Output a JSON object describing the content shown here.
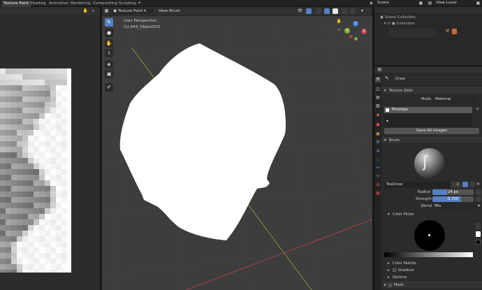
{
  "topbar": {
    "tabs": [
      "Texture Paint",
      "Shading",
      "Animation",
      "Rendering",
      "Compositing",
      "Scripting"
    ],
    "add_tab_icon": "plus-icon",
    "scene_label": "Scene",
    "view_layer_label": "View Layer"
  },
  "image_editor": {
    "pixels": "grayscale-texture"
  },
  "viewport": {
    "mode_label": "Texture Paint",
    "menu_items": [
      "View",
      "Brush"
    ],
    "perspective_label": "User Perspective",
    "object_label": "(1) 843_Object023",
    "gizmo_axes": [
      "X",
      "Y",
      "Z"
    ]
  },
  "toolbar": {
    "tools": [
      "draw-brush-icon",
      "soften-icon",
      "smear-icon",
      "clone-icon",
      "fill-icon",
      "mask-icon",
      "annotate-icon"
    ]
  },
  "outliner": {
    "root": "Scene Collection",
    "child": "Collection"
  },
  "properties": {
    "tool_name": "Draw",
    "texture_slots": {
      "title": "Texture Slots",
      "mode_label": "Mode",
      "mode_value": "Material",
      "slot_name": "Pinstripe",
      "save_all_label": "Save All Images"
    },
    "brush": {
      "title": "Brush",
      "name": "TexDraw",
      "users": "2",
      "radius_label": "Radius",
      "radius_value": "24 px",
      "radius_fraction": 0.35,
      "strength_label": "Strength",
      "strength_value": "0.700",
      "strength_fraction": 0.7,
      "blend_label": "Blend",
      "blend_value": "Mix"
    },
    "color_picker_label": "Color Picker",
    "color_palette_label": "Color Palette",
    "gradient_label": "Gradient",
    "options_label": "Options",
    "mask_label": "Mask"
  },
  "colors": {
    "accent": "#5680c2",
    "header": "#303030",
    "panel": "#2b2b2b",
    "viewport": "#3d3d3d",
    "x_axis": "#c94350",
    "y_axis": "#8aaa33",
    "z_axis": "#3b79d1"
  }
}
